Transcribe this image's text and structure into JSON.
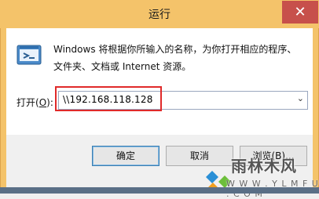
{
  "window": {
    "title": "运行",
    "close_glyph": "✕",
    "accent": "#f4c36a",
    "close_color": "#c7504b"
  },
  "dialog": {
    "description_line1": "Windows 将根据你所输入的名称，为你打开相应的程序、",
    "description_line2": "文件夹、文档或 Internet 资源。",
    "open_label": "打开",
    "open_label_accel": "O",
    "open_label_tail": "):",
    "open_value": "\\\\192.168.118.128",
    "ok_label": "确定",
    "cancel_label": "取消",
    "browse_label": "浏览(B)..."
  },
  "watermark": {
    "text": "雨林木风",
    "url": "W W W . Y L M F U . C O M"
  }
}
